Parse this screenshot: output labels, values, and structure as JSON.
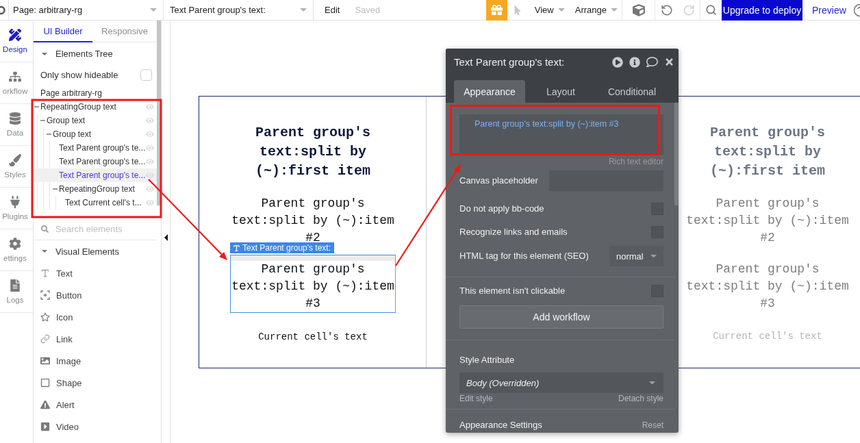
{
  "top_bar": {
    "page_selector": "Page: arbitrary-rg",
    "element_selector": "Text Parent group's text:",
    "edit_menu": "Edit",
    "save_status": "Saved",
    "menus": [
      "View",
      "Arrange"
    ],
    "undo": {
      "disabled": false
    },
    "redo": {
      "disabled": true
    },
    "upgrade_button": "Upgrade to deploy",
    "preview_link": "Preview"
  },
  "nav_rail": [
    {
      "kind": "design",
      "label": "Design",
      "selected": true
    },
    {
      "kind": "workflow",
      "label": "orkflow",
      "selected": false
    },
    {
      "kind": "data",
      "label": "Data",
      "selected": false
    },
    {
      "kind": "styles",
      "label": "Styles",
      "selected": false
    },
    {
      "kind": "plugins",
      "label": "Plugins",
      "selected": false
    },
    {
      "kind": "settings",
      "label": "ettings",
      "selected": false
    },
    {
      "kind": "logs",
      "label": "Logs",
      "selected": false
    }
  ],
  "sidebar": {
    "tabs": [
      {
        "label": "UI Builder",
        "selected": true
      },
      {
        "label": "Responsive",
        "selected": false
      }
    ],
    "elements_tree": {
      "title": "Elements Tree",
      "expanded": true,
      "filter": {
        "label": "Only show hideable",
        "checked": false
      },
      "items": [
        {
          "kind": "page",
          "label": "Page arbitrary-rg",
          "selected": false
        },
        {
          "kind": "element",
          "label": "RepeatingGroup text",
          "selected": false,
          "expanded": true,
          "children": [
            {
              "kind": "element",
              "label": "Group text",
              "selected": false,
              "expanded": true,
              "children": [
                {
                  "kind": "element",
                  "label": "Group text",
                  "selected": false,
                  "expanded": true,
                  "children": [
                    {
                      "kind": "element",
                      "label": "Text Parent group's te...",
                      "selected": false
                    },
                    {
                      "kind": "element",
                      "label": "Text Parent group's te...",
                      "selected": false
                    },
                    {
                      "kind": "element",
                      "label": "Text Parent group's te...",
                      "selected": true
                    },
                    {
                      "kind": "element",
                      "label": "RepeatingGroup text",
                      "selected": false,
                      "expanded": true,
                      "children": [
                        {
                          "kind": "element",
                          "label": "Text Current cell's t...",
                          "selected": false
                        }
                      ]
                    }
                  ]
                }
              ]
            }
          ]
        }
      ],
      "search": {
        "placeholder": "Search elements"
      }
    },
    "visual_elements": {
      "title": "Visual Elements",
      "expanded": true,
      "items": [
        {
          "kind": "text",
          "label": "Text"
        },
        {
          "kind": "button",
          "label": "Button"
        },
        {
          "kind": "icon",
          "label": "Icon"
        },
        {
          "kind": "link",
          "label": "Link"
        },
        {
          "kind": "image",
          "label": "Image"
        },
        {
          "kind": "shape",
          "label": "Shape"
        },
        {
          "kind": "alert",
          "label": "Alert"
        },
        {
          "kind": "video",
          "label": "Video"
        }
      ]
    }
  },
  "canvas": {
    "cells": [
      {
        "dimmed": false,
        "selection_label": "Text Parent group's text:",
        "texts": [
          {
            "kind": "heading",
            "text": "Parent group's text:split by (~):first item",
            "selected": false
          },
          {
            "kind": "body",
            "text": "Parent group's text:split by (~):item #2",
            "selected": false
          },
          {
            "kind": "body",
            "text": "Parent group's text:split by (~):item #3",
            "selected": true
          },
          {
            "kind": "caption",
            "text": "Current cell's text",
            "selected": false
          }
        ]
      },
      {
        "dimmed": true,
        "texts": [
          {
            "kind": "heading",
            "text": "Parent group's text:split by (~):first item",
            "selected": false
          },
          {
            "kind": "body",
            "text": "Parent group's text:split by (~):item #2",
            "selected": false
          },
          {
            "kind": "body",
            "text": "Parent group's text:split by (~):item #3",
            "selected": false
          },
          {
            "kind": "caption",
            "text": "Current cell's text",
            "selected": false
          }
        ]
      }
    ]
  },
  "property_panel": {
    "title": "Text Parent group's text:",
    "tabs": [
      {
        "label": "Appearance",
        "selected": true
      },
      {
        "label": "Layout",
        "selected": false
      },
      {
        "label": "Conditional",
        "selected": false
      }
    ],
    "sections": [
      {
        "rows": [
          {
            "kind": "editor",
            "value": "Parent group's text:split by (~):item #3",
            "hint": "Rich text editor"
          },
          {
            "kind": "input",
            "label": "Canvas placeholder"
          },
          {
            "kind": "checkbox",
            "label": "Do not apply bb-code",
            "checked": false
          },
          {
            "kind": "checkbox",
            "label": "Recognize links and emails",
            "checked": false
          },
          {
            "kind": "select",
            "label": "HTML tag for this element (SEO)",
            "value": "normal"
          }
        ]
      },
      {
        "rows": [
          {
            "kind": "checkbox",
            "label": "This element isn't clickable",
            "checked": false
          },
          {
            "kind": "button",
            "label": "Add workflow"
          }
        ]
      },
      {
        "rows": [
          {
            "kind": "style",
            "label": "Style Attribute",
            "value": "Body (Overridden)",
            "links": [
              "Edit style",
              "Detach style"
            ]
          }
        ]
      },
      {
        "rows": [
          {
            "kind": "header",
            "label": "Appearance Settings",
            "action": "Reset"
          }
        ]
      }
    ]
  }
}
